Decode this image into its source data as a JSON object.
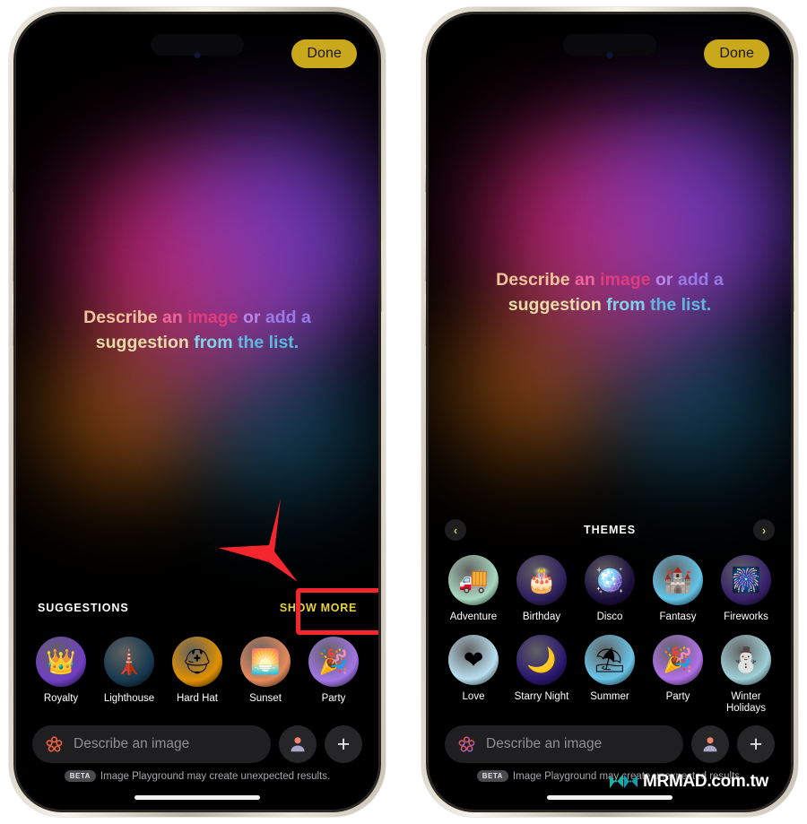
{
  "meta": {
    "app_name": "Image Playground",
    "accent_yellow": "#c9a91b",
    "show_more_yellow": "#e8d23a",
    "annotation_red": "#f5252e"
  },
  "hero": {
    "segments": [
      {
        "text": "Describe ",
        "color": "#f0c49a"
      },
      {
        "text": "an ",
        "color": "#f0659c"
      },
      {
        "text": "image ",
        "color": "#e03b7e"
      },
      {
        "text": "or ",
        "color": "#b886e8"
      },
      {
        "text": "add a ",
        "color": "#9a7ae8"
      },
      {
        "text": "suggestion ",
        "color": "#e8dba8"
      },
      {
        "text": "from ",
        "color": "#7fd4e8"
      },
      {
        "text": "the list.",
        "color": "#5fb8e0"
      }
    ],
    "plain_text": "Describe an image or add a suggestion from the list."
  },
  "topbar": {
    "done_label": "Done"
  },
  "left_phone": {
    "suggestions_section": {
      "title": "SUGGESTIONS",
      "show_more_label": "SHOW MORE",
      "items": [
        {
          "label": "Royalty",
          "glyph": "👑",
          "bg": "#6f3fc4"
        },
        {
          "label": "Lighthouse",
          "glyph": "🗼",
          "bg": "#16384f"
        },
        {
          "label": "Hard Hat",
          "glyph": "⛑",
          "bg": "#e09000"
        },
        {
          "label": "Sunset",
          "glyph": "🌅",
          "bg": "#e58a5a"
        },
        {
          "label": "Party",
          "glyph": "🎉",
          "bg": "#a175e6"
        }
      ]
    }
  },
  "right_phone": {
    "themes_section": {
      "title": "THEMES",
      "prev_label": "‹",
      "next_label": "›",
      "items": [
        {
          "label": "Adventure",
          "glyph": "🚚",
          "bg": "#a8d8c0"
        },
        {
          "label": "Birthday",
          "glyph": "🎂",
          "bg": "#2f2060"
        },
        {
          "label": "Disco",
          "glyph": "🪩",
          "bg": "#1c1040"
        },
        {
          "label": "Fantasy",
          "glyph": "🏰",
          "bg": "#63c4e8"
        },
        {
          "label": "Fireworks",
          "glyph": "🎆",
          "bg": "#38206b"
        },
        {
          "label": "Love",
          "glyph": "❤",
          "bg": "#b9dff0"
        },
        {
          "label": "Starry Night",
          "glyph": "🌙",
          "bg": "#2a1870"
        },
        {
          "label": "Summer",
          "glyph": "⛱",
          "bg": "#68c4e8"
        },
        {
          "label": "Party",
          "glyph": "🎉",
          "bg": "#b071e8"
        },
        {
          "label": "Winter Holidays",
          "glyph": "⛄",
          "bg": "#9fd0d8"
        }
      ]
    }
  },
  "composer": {
    "placeholder": "Describe an image",
    "person_icon": "person-icon",
    "add_icon": "plus-icon",
    "playground_icon": "image-playground-flower-icon"
  },
  "disclaimer": {
    "badge": "BETA",
    "text": "Image Playground may create unexpected results."
  },
  "watermark": {
    "brand": "MRMAD",
    "domain": ".com.tw"
  }
}
